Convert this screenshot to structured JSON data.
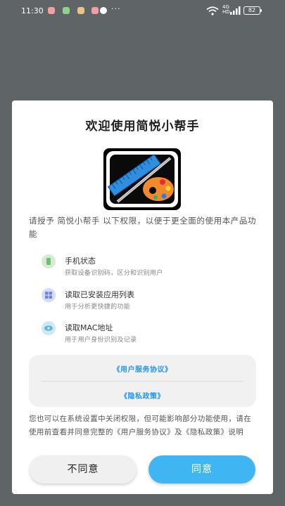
{
  "status_bar": {
    "time": "11:30",
    "more": "···",
    "network": "4G",
    "network_sub": "HD",
    "battery": "82"
  },
  "dialog": {
    "title": "欢迎使用简悦小帮手",
    "intro": "请授予 简悦小帮手 以下权限，以便于更全面的使用本产品功能",
    "permissions": [
      {
        "title": "手机状态",
        "desc": "获取设备识别码，区分和识别用户",
        "icon": "phone-state-icon",
        "color": "#6fbf73"
      },
      {
        "title": "读取已安装应用列表",
        "desc": "用于分析更快捷的功能",
        "icon": "app-grid-icon",
        "color": "#6d86d9"
      },
      {
        "title": "读取MAC地址",
        "desc": "用于用户身份识别及记录",
        "icon": "eye-icon",
        "color": "#5cb6d8"
      }
    ],
    "links": {
      "user_agreement": "《用户服务协议》",
      "privacy_policy": "《隐私政策》"
    },
    "note": "您也可以在系统设置中关闭权限，但可能影响部分功能使用，请在使用前查看并同意完整的《用户服务协议》及《隐私政策》说明",
    "buttons": {
      "disagree": "不同意",
      "agree": "同意"
    }
  },
  "colors": {
    "overlay": "#5f6467",
    "accent": "#3fb6f2",
    "link": "#2196f3"
  }
}
